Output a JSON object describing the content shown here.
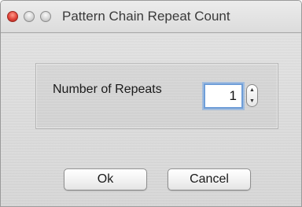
{
  "window": {
    "title": "Pattern Chain Repeat Count"
  },
  "form": {
    "repeats_label": "Number of Repeats",
    "repeats_value": "1"
  },
  "buttons": {
    "ok_label": "Ok",
    "cancel_label": "Cancel"
  },
  "icons": {
    "close": "close-icon",
    "minimize": "minimize-icon",
    "zoom": "zoom-icon",
    "stepper_up": "chevron-up-icon",
    "stepper_down": "chevron-down-icon"
  },
  "colors": {
    "close_button": "#e0443a",
    "focus_ring": "#6f9ed8"
  }
}
